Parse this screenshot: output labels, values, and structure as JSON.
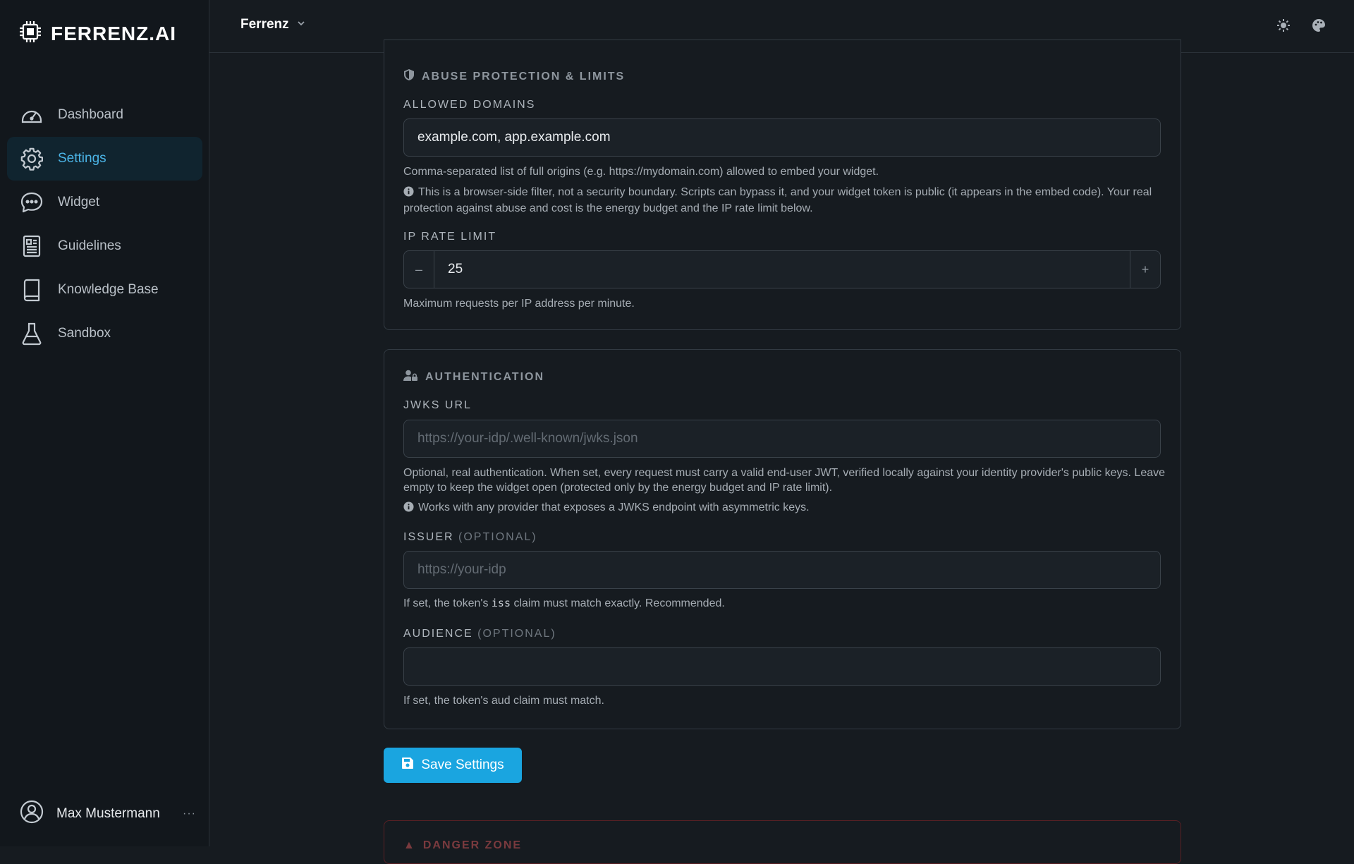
{
  "app": {
    "name": "FERRENZ.AI"
  },
  "sidebar": {
    "items": [
      {
        "label": "Dashboard",
        "icon": "dashboard-icon"
      },
      {
        "label": "Settings",
        "icon": "gear-icon",
        "active": true
      },
      {
        "label": "Widget",
        "icon": "chat-bubble-icon"
      },
      {
        "label": "Guidelines",
        "icon": "document-icon"
      },
      {
        "label": "Knowledge Base",
        "icon": "book-icon"
      },
      {
        "label": "Sandbox",
        "icon": "flask-icon"
      }
    ],
    "user": {
      "name": "Max Mustermann",
      "more": "···"
    }
  },
  "topbar": {
    "workspace": "Ferrenz"
  },
  "abuse": {
    "title": "ABUSE PROTECTION & LIMITS",
    "allowed_domains": {
      "label": "ALLOWED DOMAINS",
      "value": "example.com, app.example.com",
      "help": "Comma-separated list of full origins (e.g. https://mydomain.com) allowed to embed your widget.",
      "info": "This is a browser-side filter, not a security boundary. Scripts can bypass it, and your widget token is public (it appears in the embed code). Your real protection against abuse and cost is the energy budget and the IP rate limit below."
    },
    "ip_rate_limit": {
      "label": "IP RATE LIMIT",
      "value": "25",
      "minus": "–",
      "plus": "+",
      "help": "Maximum requests per IP address per minute."
    }
  },
  "auth": {
    "title": "AUTHENTICATION",
    "jwks": {
      "label": "JWKS URL",
      "placeholder": "https://your-idp/.well-known/jwks.json",
      "help": "Optional, real authentication. When set, every request must carry a valid end-user JWT, verified locally against your identity provider's public keys. Leave empty to keep the widget open (protected only by the energy budget and IP rate limit).",
      "info": "Works with any provider that exposes a JWKS endpoint with asymmetric keys."
    },
    "issuer": {
      "label": "ISSUER",
      "optional": "(OPTIONAL)",
      "placeholder": "https://your-idp",
      "help_pre": "If set, the token's ",
      "help_code": "iss",
      "help_post": " claim must match exactly. Recommended."
    },
    "audience": {
      "label": "AUDIENCE",
      "optional": "(OPTIONAL)",
      "placeholder": "",
      "help": "If set, the token's aud claim must match."
    }
  },
  "save_button": {
    "label": "Save Settings"
  },
  "danger": {
    "title": "DANGER ZONE"
  },
  "colors": {
    "accent": "#1aa5e0",
    "active_nav": "#4bb4e6",
    "background": "#161b20",
    "sidebar": "#12171c"
  }
}
